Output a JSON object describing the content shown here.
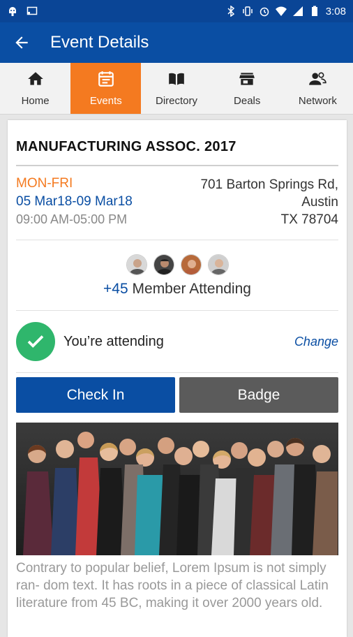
{
  "status_bar": {
    "time": "3:08",
    "left_icons": [
      "android-icon",
      "cast-icon"
    ],
    "right_icons": [
      "bluetooth-icon",
      "vibrate-icon",
      "alarm-icon",
      "wifi-icon",
      "signal-icon",
      "battery-icon"
    ]
  },
  "app_bar": {
    "title": "Event Details",
    "back_icon": "arrow-left-icon"
  },
  "tabs": [
    {
      "label": "Home",
      "icon": "home-icon",
      "active": false
    },
    {
      "label": "Events",
      "icon": "calendar-icon",
      "active": true
    },
    {
      "label": "Directory",
      "icon": "book-icon",
      "active": false
    },
    {
      "label": "Deals",
      "icon": "store-icon",
      "active": false
    },
    {
      "label": "Network",
      "icon": "people-icon",
      "active": false
    }
  ],
  "event": {
    "title": "MANUFACTURING ASSOC. 2017",
    "days": "MON-FRI",
    "date_range": "05 Mar18-09 Mar18",
    "time": "09:00 AM-05:00 PM",
    "address_line1": "701 Barton Springs Rd,",
    "address_line2": "Austin",
    "address_line3": "TX 78704"
  },
  "attendees": {
    "count": "+45",
    "label": "Member Attending",
    "avatar_count": 4
  },
  "attending_status": {
    "label": "You’re attending",
    "change_label": "Change"
  },
  "actions": {
    "check_in_label": "Check In",
    "badge_label": "Badge"
  },
  "description": "Contrary to popular belief, Lorem Ipsum is not simply ran- dom text. It has roots in a piece of classical Latin literature from 45 BC, making it over 2000 years old.",
  "colors": {
    "primary": "#0a4ea3",
    "accent": "#f47a20",
    "success": "#2fb66c"
  }
}
